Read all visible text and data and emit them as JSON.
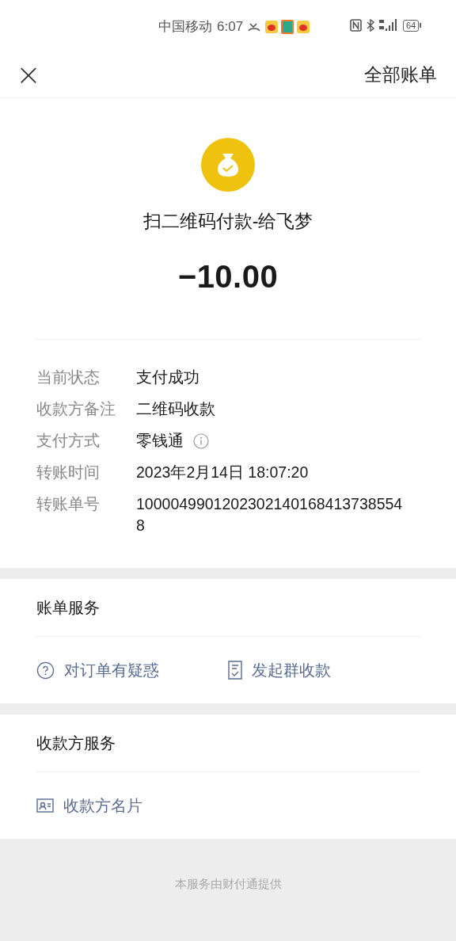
{
  "status_bar": {
    "carrier": "中国移动",
    "time": "6:07",
    "battery": "64"
  },
  "header": {
    "close": "×",
    "title": "全部账单"
  },
  "transaction": {
    "title": "扫二维码付款-给飞梦",
    "amount": "−10.00"
  },
  "details": [
    {
      "label": "当前状态",
      "value": "支付成功",
      "info": false
    },
    {
      "label": "收款方备注",
      "value": "二维码收款",
      "info": false
    },
    {
      "label": "支付方式",
      "value": "零钱通",
      "info": true
    },
    {
      "label": "转账时间",
      "value": "2023年2月14日 18:07:20",
      "info": false
    },
    {
      "label": "转账单号",
      "value": "10000499012023021401684137385548",
      "info": false
    }
  ],
  "sections": [
    {
      "title": "账单服务",
      "actions": [
        {
          "kind": "question",
          "label": "对订单有疑惑"
        },
        {
          "kind": "receipt",
          "label": "发起群收款"
        }
      ]
    },
    {
      "title": "收款方服务",
      "actions": [
        {
          "kind": "card",
          "label": "收款方名片"
        }
      ]
    }
  ],
  "footer": "本服务由财付通提供"
}
